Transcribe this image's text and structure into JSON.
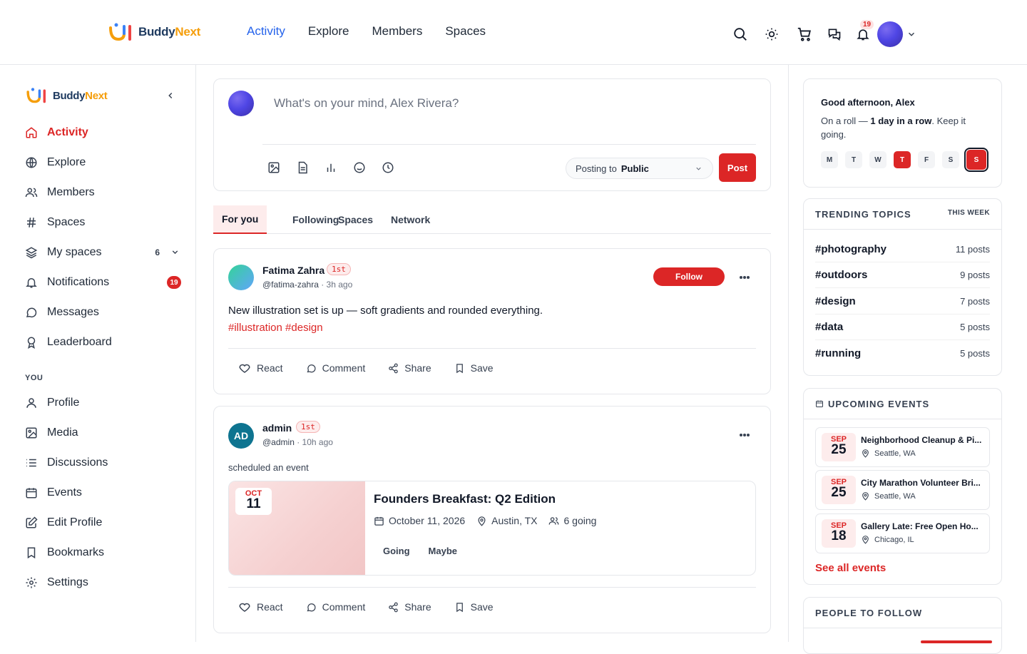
{
  "brand": {
    "name_part1": "Buddy",
    "name_part2": "Next"
  },
  "topnav": [
    {
      "label": "Activity",
      "active": true
    },
    {
      "label": "Explore"
    },
    {
      "label": "Members"
    },
    {
      "label": "Spaces"
    }
  ],
  "top": {
    "notif_count": "19"
  },
  "sidebar": {
    "items": [
      {
        "label": "Activity",
        "icon": "home-icon"
      },
      {
        "label": "Explore",
        "icon": "globe-icon"
      },
      {
        "label": "Members",
        "icon": "users-icon"
      },
      {
        "label": "Spaces",
        "icon": "hash-icon"
      },
      {
        "label": "My spaces",
        "icon": "layers-icon",
        "count": "6"
      },
      {
        "label": "Notifications",
        "icon": "bell-icon",
        "badge": "19"
      },
      {
        "label": "Messages",
        "icon": "message-icon"
      },
      {
        "label": "Leaderboard",
        "icon": "award-icon"
      }
    ],
    "section_you": "YOU",
    "you_items": [
      {
        "label": "Profile",
        "icon": "user-icon"
      },
      {
        "label": "Media",
        "icon": "image-icon"
      },
      {
        "label": "Discussions",
        "icon": "list-icon"
      },
      {
        "label": "Events",
        "icon": "calendar-icon"
      },
      {
        "label": "Edit Profile",
        "icon": "edit-icon"
      },
      {
        "label": "Bookmarks",
        "icon": "bookmark-icon"
      },
      {
        "label": "Settings",
        "icon": "gear-icon"
      }
    ]
  },
  "composer": {
    "placeholder": "What's on your mind, Alex Rivera?",
    "posting_to_label": "Posting to",
    "posting_to_value": "Public",
    "post_button": "Post"
  },
  "tabs": [
    "For you",
    "Following",
    "Spaces",
    "Network"
  ],
  "posts": [
    {
      "author": "Fatima Zahra",
      "degree": "1st",
      "handle": "@fatima-zahra",
      "time": "3h ago",
      "follow_label": "Follow",
      "text": "New illustration set is up — soft gradients and rounded everything.",
      "tags": "#illustration #design"
    },
    {
      "author": "admin",
      "initials": "AD",
      "degree": "1st",
      "handle": "@admin",
      "time": "10h ago",
      "activity": "scheduled an event",
      "event": {
        "month": "OCT",
        "day": "11",
        "title": "Founders Breakfast: Q2 Edition",
        "date": "October 11, 2026",
        "location": "Austin, TX",
        "going": "6 going",
        "going_btn": "Going",
        "maybe_btn": "Maybe"
      }
    }
  ],
  "post_actions": {
    "react": "React",
    "comment": "Comment",
    "share": "Share",
    "save": "Save"
  },
  "greeting": {
    "title": "Good afternoon, Alex",
    "sub_pre": "On a roll — ",
    "sub_bold": "1 day in a row",
    "sub_post": ". Keep it going.",
    "days": [
      "M",
      "T",
      "W",
      "T",
      "F",
      "S",
      "S"
    ]
  },
  "trending": {
    "title": "TRENDING TOPICS",
    "subtitle": "THIS WEEK",
    "items": [
      {
        "tag": "#photography",
        "count": "11 posts"
      },
      {
        "tag": "#outdoors",
        "count": "9 posts"
      },
      {
        "tag": "#design",
        "count": "7 posts"
      },
      {
        "tag": "#data",
        "count": "5 posts"
      },
      {
        "tag": "#running",
        "count": "5 posts"
      }
    ]
  },
  "events": {
    "title": "UPCOMING EVENTS",
    "items": [
      {
        "month": "SEP",
        "day": "25",
        "name": "Neighborhood Cleanup & Pi...",
        "location": "Seattle, WA"
      },
      {
        "month": "SEP",
        "day": "25",
        "name": "City Marathon Volunteer Bri...",
        "location": "Seattle, WA"
      },
      {
        "month": "SEP",
        "day": "18",
        "name": "Gallery Late: Free Open Ho...",
        "location": "Chicago, IL"
      }
    ],
    "see_all": "See all events"
  },
  "people": {
    "title": "PEOPLE TO FOLLOW"
  },
  "colors": {
    "accent": "#dc2626",
    "link": "#2563eb",
    "brand_blue": "#1e3a5f",
    "brand_orange": "#f59e0b"
  }
}
